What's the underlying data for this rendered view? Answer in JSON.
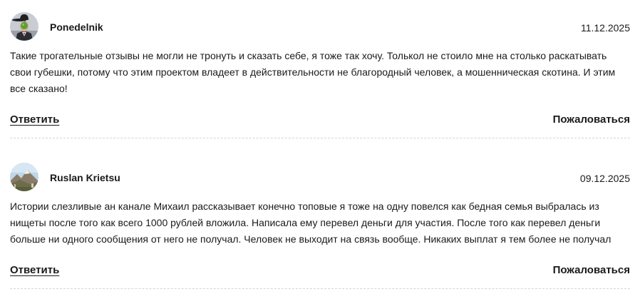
{
  "comments": [
    {
      "author": "Ponedelnik",
      "date": "11.12.2025",
      "avatar_icon": "man-bowler-hat-apple-avatar",
      "text": "Такие трогательные отзывы не могли не тронуть и сказать себе, я тоже так хочу. Толькол не стоило мне на столько раскатывать свои губешки, потому что этим проектом владеет в действительности не благородный человек, а мошенническая скотина. И этим все сказано!",
      "reply_label": "Ответить",
      "report_label": "Пожаловаться"
    },
    {
      "author": "Ruslan Krietsu",
      "date": "09.12.2025",
      "avatar_icon": "landscape-photo-avatar",
      "text": "Истории слезливые ан канале Михаил рассказывает конечно топовые я тоже на одну повелся как бедная семья выбралась из нищеты после того как всего 1000 рублей вложила. Написала ему перевел деньги для участия. После того как перевел деньги больше ни одного сообщения от него не получал. Человек не выходит на связь вообще. Никаких выплат я тем более не получал",
      "reply_label": "Ответить",
      "report_label": "Пожаловаться"
    }
  ],
  "colors": {
    "text": "#1a1a1a",
    "divider": "#d4d4d4",
    "background": "#ffffff"
  }
}
